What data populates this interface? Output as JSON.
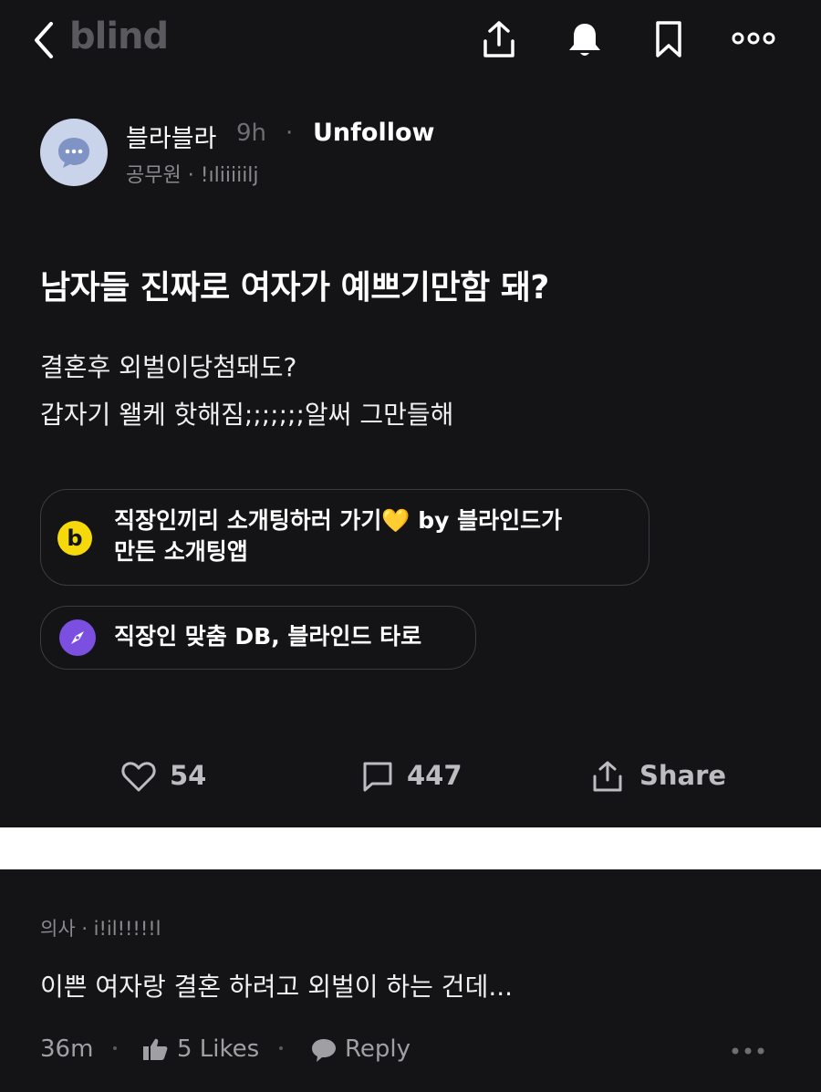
{
  "header": {
    "logo": "blind",
    "icons": [
      "back-chevron-icon",
      "share-icon",
      "bell-icon",
      "bookmark-icon",
      "more-icon"
    ]
  },
  "post": {
    "author": "블라블라",
    "time": "9h",
    "separator": "·",
    "follow_label": "Unfollow",
    "company_line": "공무원 · !ıliiiiilj",
    "title": "남자들 진짜로 여자가 예쁘기만함 돼?",
    "body_line1": "결혼후 외벌이당첨돼도?",
    "body_line2": "갑자기 왤케 핫해짐;;;;;;;알써 그만들해"
  },
  "promos": [
    {
      "icon_letter": "b",
      "line1": "직장인끼리 소개팅하러 가기💛 by 블라인드가",
      "line2": "만든 소개팅앱",
      "icon_color": "#f5d90a"
    },
    {
      "line1": "직장인 맞춤 DB, 블라인드 타로",
      "icon_color": "#7b4fe0"
    }
  ],
  "stats": {
    "likes": "54",
    "comments": "447",
    "share_label": "Share"
  },
  "comment": {
    "meta": "의사 · i!il!!!!!l",
    "text": "이쁜 여자랑 결혼 하려고 외벌이 하는 건데...",
    "time": "36m",
    "likes": "5 Likes",
    "reply_label": "Reply"
  },
  "colors": {
    "background": "#141416",
    "avatar": "#c9d4ea",
    "accent_yellow": "#f5d90a",
    "accent_purple": "#7b4fe0"
  }
}
